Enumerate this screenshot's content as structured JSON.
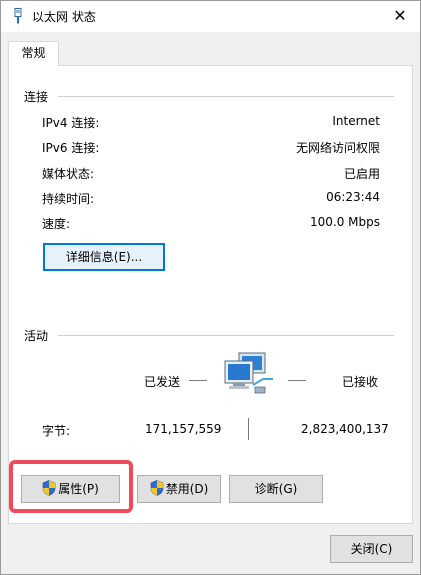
{
  "window": {
    "title": "以太网 状态",
    "close_glyph": "✕"
  },
  "tabs": [
    {
      "label": "常规"
    }
  ],
  "connection": {
    "section_label": "连接",
    "rows": [
      {
        "label": "IPv4 连接:",
        "value": "Internet"
      },
      {
        "label": "IPv6 连接:",
        "value": "无网络访问权限"
      },
      {
        "label": "媒体状态:",
        "value": "已启用"
      },
      {
        "label": "持续时间:",
        "value": "06:23:44"
      },
      {
        "label": "速度:",
        "value": "100.0 Mbps"
      }
    ],
    "details_button": "详细信息(E)..."
  },
  "activity": {
    "section_label": "活动",
    "sent_label": "已发送",
    "received_label": "已接收",
    "bytes_label": "字节:",
    "bytes_sent": "171,157,559",
    "bytes_received": "2,823,400,137",
    "icon": "network-computers-icon"
  },
  "actions": {
    "properties": "属性(P)",
    "disable": "禁用(D)",
    "diagnose": "诊断(G)",
    "shield_icon": "uac-shield-icon"
  },
  "footer": {
    "close": "关闭(C)"
  },
  "colors": {
    "highlight": "#f04a5c",
    "focus_border": "#0078d7"
  }
}
